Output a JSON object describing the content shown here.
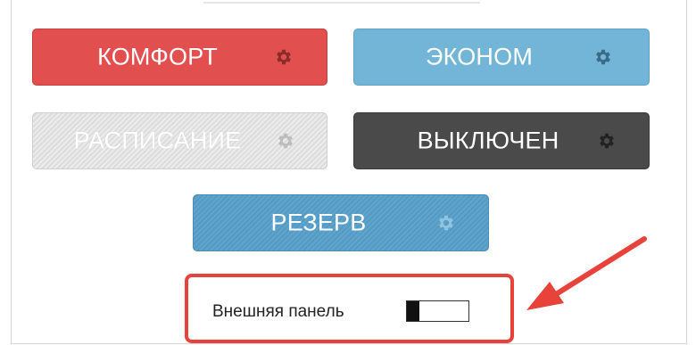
{
  "modes": {
    "comfort": {
      "label": "КОМФОРТ",
      "icon": "gear-icon",
      "color": "#e14f4f"
    },
    "econom": {
      "label": "ЭКОНОМ",
      "icon": "gear-icon",
      "color": "#72b5d7"
    },
    "schedule": {
      "label": "РАСПИСАНИЕ",
      "icon": "gear-icon",
      "color": "#dcdcdc",
      "state": "disabled"
    },
    "off": {
      "label": "ВЫКЛЮЧЕН",
      "icon": "gear-icon",
      "color": "#4a4a4a"
    },
    "reserve": {
      "label": "РЕЗЕРВ",
      "icon": "gear-icon",
      "color": "#5ea4cc"
    }
  },
  "external_panel": {
    "label": "Внешняя панель",
    "toggle_state": "off"
  },
  "annotation": {
    "highlight_color": "#e8433a",
    "arrow_icon": "arrow-icon"
  }
}
